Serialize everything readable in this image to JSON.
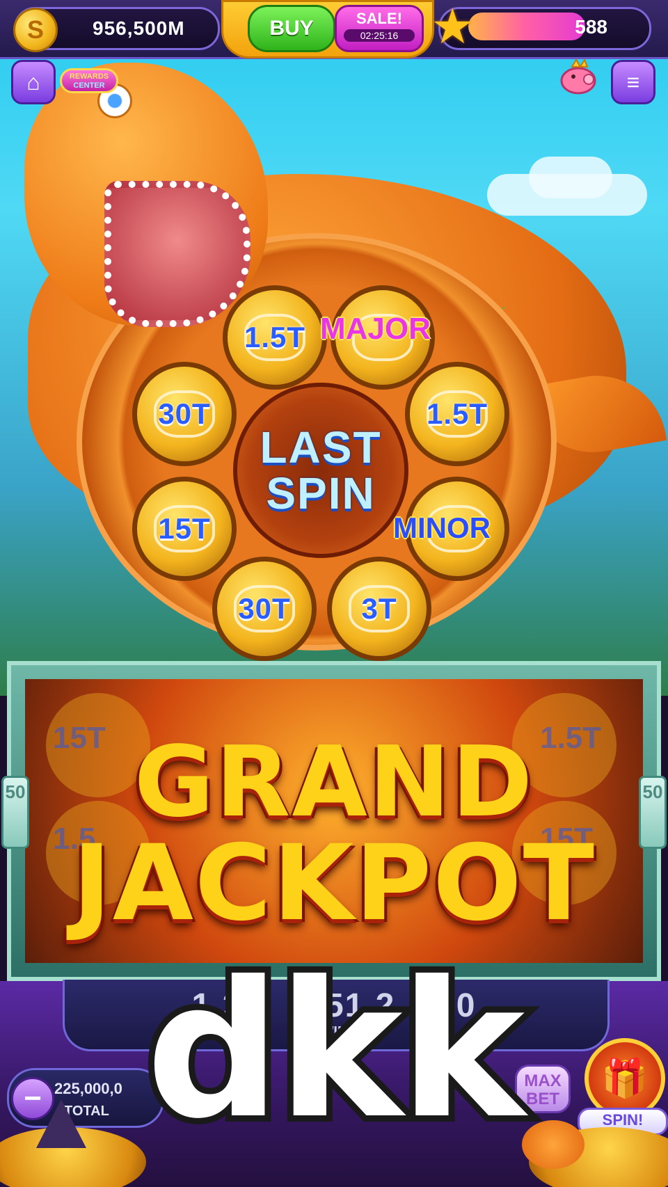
{
  "top_bar": {
    "coin_icon_glyph": "S",
    "coins": "956,500M",
    "buy_label": "BUY",
    "sale_label": "SALE!",
    "sale_timer": "02:25:16",
    "level_value": "588",
    "level_progress": 0.7
  },
  "nav": {
    "home_icon": "home-icon",
    "rewards_label_line1": "REWARDS",
    "rewards_label_line2": "CENTER",
    "piggy_bank_icon": "piggy-bank-icon",
    "menu_icon": "menu-icon"
  },
  "wheel": {
    "center_line1": "LAST",
    "center_line2": "SPIN",
    "segments": [
      "1.5T",
      "MAJOR",
      "1.5T",
      "MINOR",
      "3T",
      "30T",
      "15T",
      "30T"
    ]
  },
  "reel": {
    "banner_line1": "GRAND",
    "banner_line2": "JACKPOT",
    "side_left": "50",
    "side_right": "50",
    "bg_labels": [
      "15T",
      "1.5T",
      "1.5",
      "15T"
    ]
  },
  "bottom": {
    "win_amount": "1,25",
    "win_amount_mid": "51,2",
    "win_amount_end": "620",
    "win_label": "WIN",
    "total_bet": "225,000,0",
    "total_label": "TOTAL",
    "max_bet_line1": "MAX",
    "max_bet_line2": "BET",
    "spin_label": "SPIN!"
  },
  "overlay_text": "dkk",
  "colors": {
    "accent_purple": "#7a3de0",
    "buy_green": "#2fb31b",
    "sale_magenta": "#c21fc2",
    "jackpot_gold": "#ffd21a",
    "label_blue": "#2a5dff"
  }
}
